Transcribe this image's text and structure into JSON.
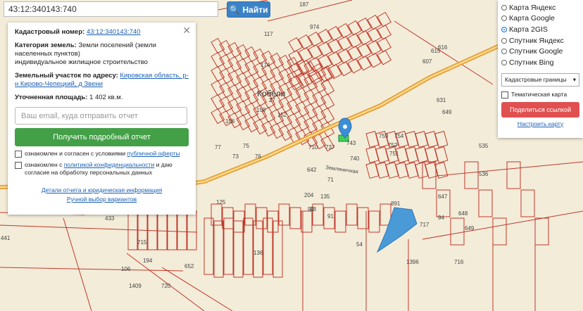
{
  "search": {
    "value": "43:12:340143:740",
    "button_label": "Найти"
  },
  "info_panel": {
    "cadastral_label": "Кадастровый номер:",
    "cadastral_value": "43:12:340143:740",
    "category_label": "Категория земель:",
    "category_value": "Земли поселений (земли населенных пунктов)",
    "usage_value": "индивидуальное жилищное строительство",
    "address_label": "Земельный участок по адресу:",
    "address_value": "Кировская область, р-н Кирово-Чепецкий, д Звени",
    "area_label": "Уточненная площадь:",
    "area_value": "1 402 кв.м.",
    "email_placeholder": "Ваш email, куда отправить отчет",
    "get_report_button": "Получить подробный отчет",
    "agree1_text": "ознакомлен и согласен с условиями ",
    "agree1_link": "публичной оферты",
    "agree2_text": "ознакомлен с ",
    "agree2_link": "политикой конфиденциальности",
    "agree2_tail": " и даю согласие на обработку персональных данных",
    "details_link": "Детали отчета и юридическая информация",
    "manual_link": "Ручной выбор вариантов"
  },
  "layers": {
    "options": [
      "Карта Яндекс",
      "Карта Google",
      "Карта 2GIS",
      "Спутник Яндекс",
      "Спутник Google",
      "Спутник Bing"
    ],
    "selected": "Карта 2GIS",
    "overlay_select": "Кадастровые границы",
    "thematic_label": "Тематическая карта",
    "share_button": "Поделиться ссылкой",
    "configure_link": "Настроить карту"
  },
  "map": {
    "place_name": "Кобели",
    "street_name": "Земляничная",
    "parcel_labels": [
      "187",
      "117",
      "974",
      "174",
      "27",
      "106",
      "159",
      "152",
      "75",
      "76",
      "77",
      "73",
      "710",
      "737",
      "743",
      "740",
      "759",
      "754",
      "752",
      "751",
      "649",
      "642",
      "71",
      "204",
      "135",
      "891",
      "717",
      "94",
      "648",
      "535",
      "536",
      "647",
      "649",
      "433",
      "441",
      "715",
      "652",
      "720",
      "1409",
      "1396",
      "716",
      "194",
      "106",
      "93",
      "90",
      "91",
      "136",
      "54",
      "125",
      "631",
      "607",
      "615",
      "616"
    ]
  },
  "colors": {
    "accent": "#3b83c8",
    "report": "#43a047",
    "share": "#e05050",
    "boundary": "#c0392b",
    "road": "#e9a23b"
  }
}
